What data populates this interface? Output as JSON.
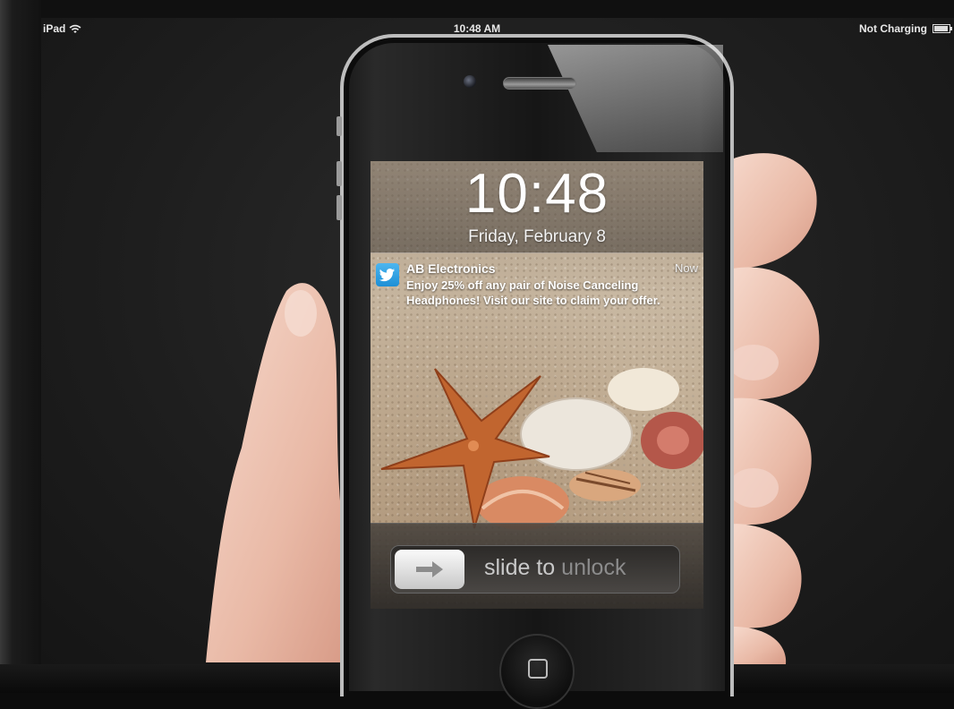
{
  "status_bar": {
    "device": "iPad",
    "time": "10:48 AM",
    "battery_text": "Not Charging"
  },
  "lock_screen": {
    "time": "10:48",
    "date": "Friday, February 8"
  },
  "notification": {
    "app_icon": "twitter-bird-icon",
    "title": "AB Electronics",
    "time": "Now",
    "body": "Enjoy 25% off any pair of Noise Canceling Headphones! Visit our site to claim your offer."
  },
  "unlock": {
    "label_part1": "slide to ",
    "label_part2": "unlock",
    "arrow_icon": "right-arrow-icon"
  },
  "colors": {
    "notification_icon": "#1d8fd6",
    "background": "#1d1d1d"
  }
}
